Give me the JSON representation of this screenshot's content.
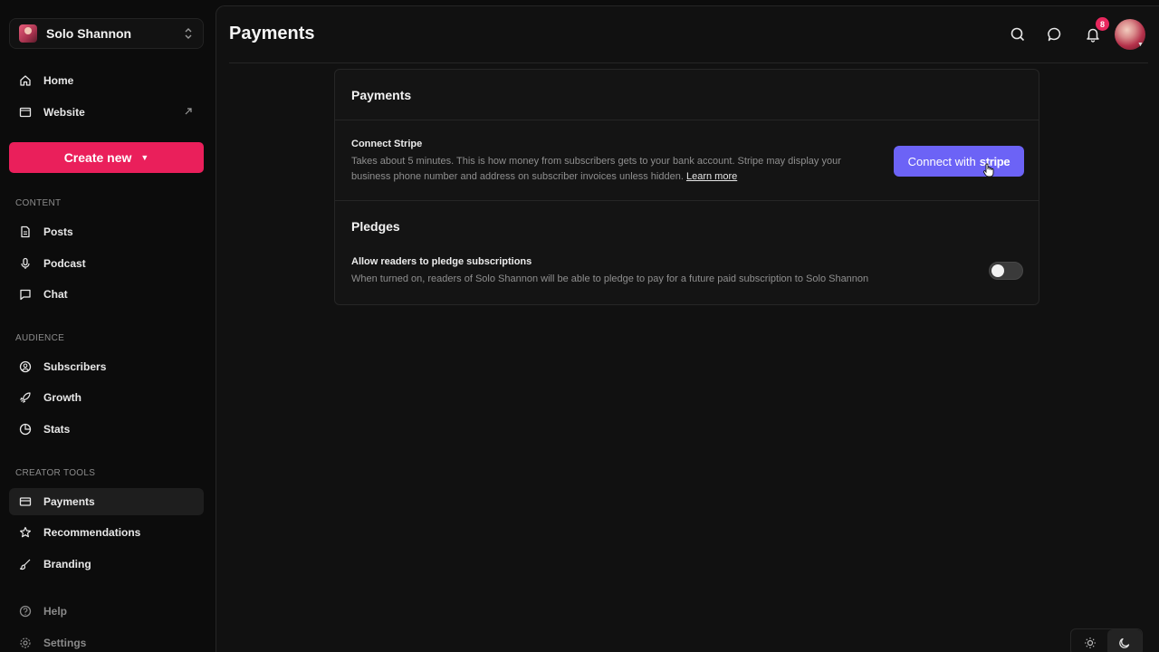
{
  "publication": {
    "name": "Solo Shannon"
  },
  "sidebar": {
    "top_items": [
      {
        "label": "Home",
        "icon": "home-icon"
      },
      {
        "label": "Website",
        "icon": "website-icon"
      }
    ],
    "create_label": "Create new",
    "content_label": "CONTENT",
    "content_items": [
      {
        "label": "Posts",
        "icon": "document-icon"
      },
      {
        "label": "Podcast",
        "icon": "microphone-icon"
      },
      {
        "label": "Chat",
        "icon": "chat-icon"
      }
    ],
    "audience_label": "AUDIENCE",
    "audience_items": [
      {
        "label": "Subscribers",
        "icon": "user-circle-icon"
      },
      {
        "label": "Growth",
        "icon": "rocket-icon"
      },
      {
        "label": "Stats",
        "icon": "pie-chart-icon"
      }
    ],
    "creator_label": "CREATOR TOOLS",
    "creator_items": [
      {
        "label": "Payments",
        "icon": "credit-card-icon",
        "active": true
      },
      {
        "label": "Recommendations",
        "icon": "star-icon"
      },
      {
        "label": "Branding",
        "icon": "brush-icon"
      }
    ],
    "bottom_items": [
      {
        "label": "Help",
        "icon": "help-icon"
      },
      {
        "label": "Settings",
        "icon": "gear-icon"
      }
    ]
  },
  "header": {
    "title": "Payments",
    "notification_count": "8"
  },
  "payments": {
    "heading": "Payments",
    "connect_title": "Connect Stripe",
    "connect_desc_1": "Takes about 5 minutes. This is how money from subscribers gets to your bank account. Stripe may display your",
    "connect_desc_2": "business phone number and address on subscriber invoices unless hidden.",
    "learn_more": "Learn more",
    "button_prefix": "Connect with",
    "button_brand": "stripe"
  },
  "pledges": {
    "heading": "Pledges",
    "title": "Allow readers to pledge subscriptions",
    "desc": "When turned on, readers of Solo Shannon will be able to pledge to pay for a future paid subscription to Solo Shannon",
    "enabled": false
  },
  "colors": {
    "accent": "#ea1f5b",
    "stripe": "#6c63f6",
    "badge": "#e8285e"
  }
}
